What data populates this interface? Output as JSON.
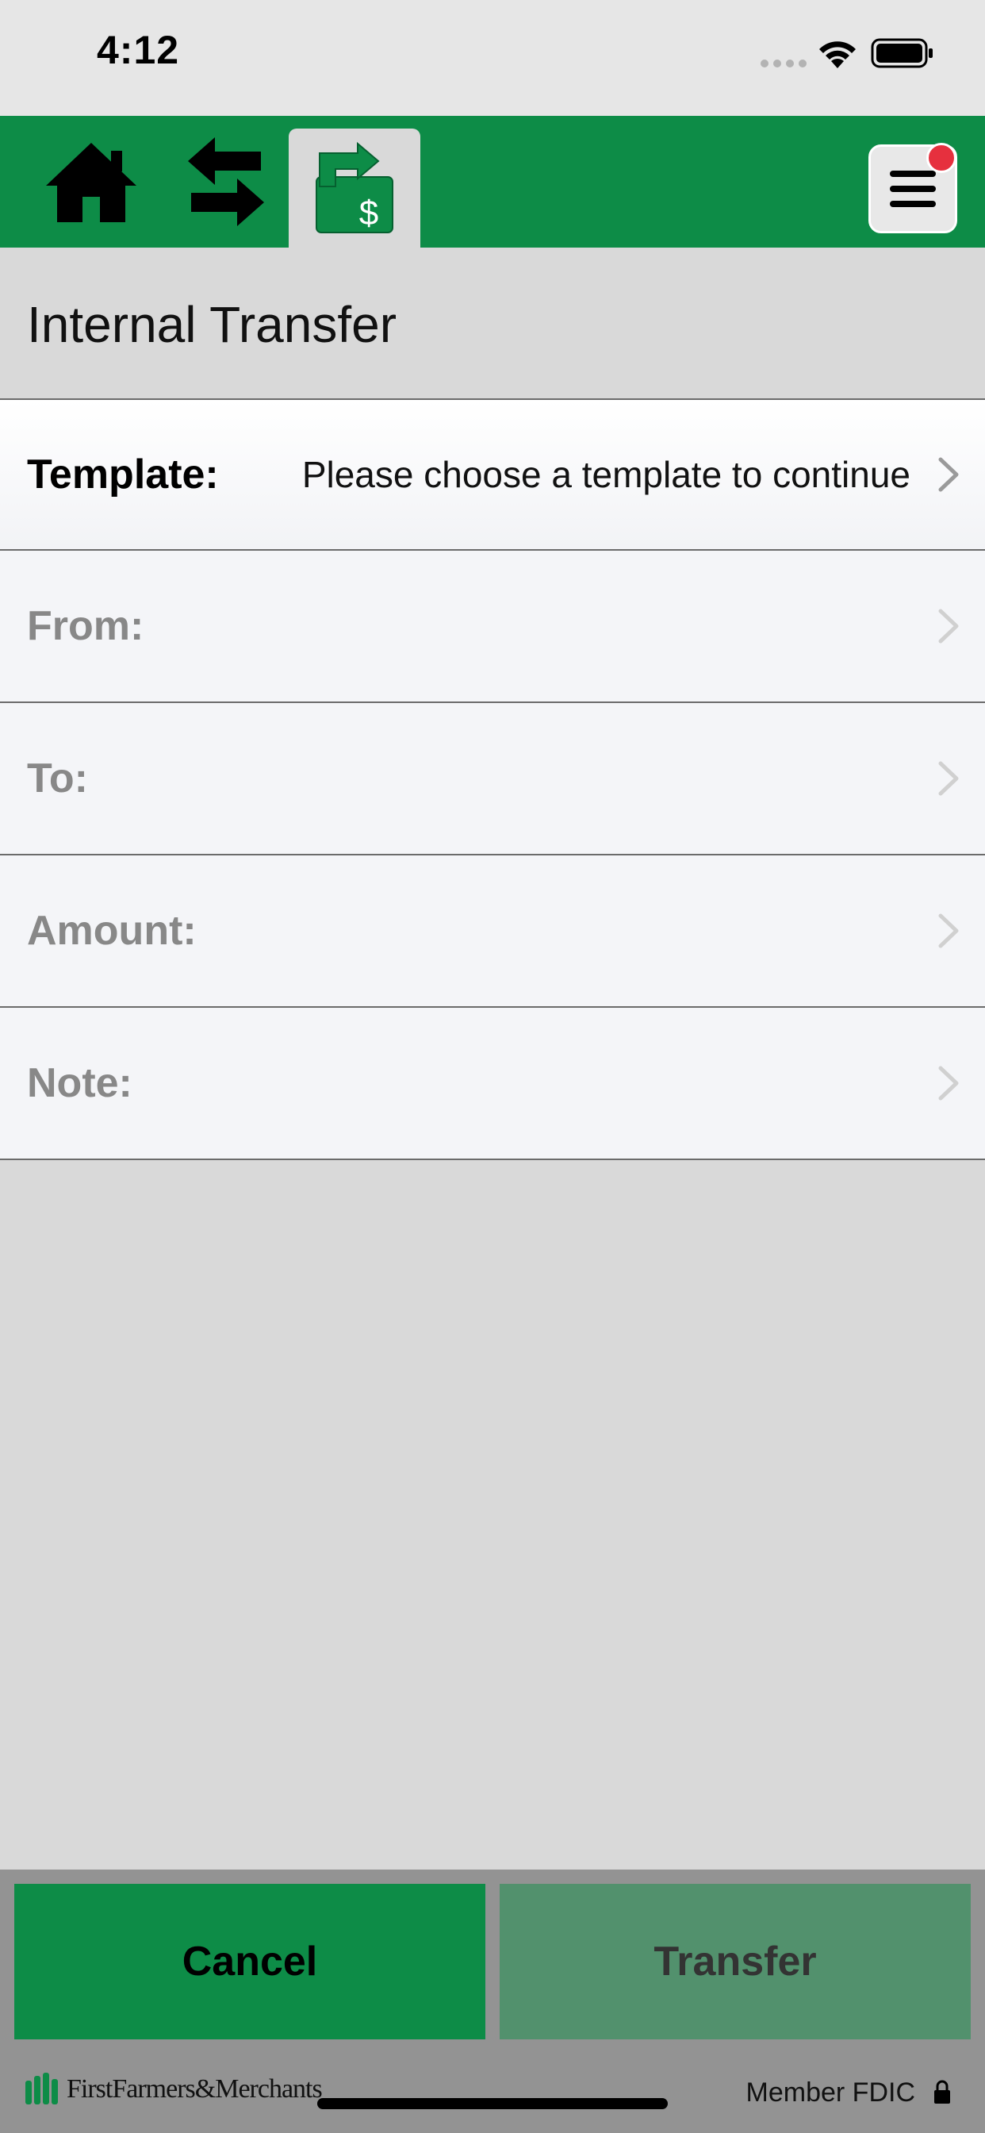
{
  "status_bar": {
    "time": "4:12"
  },
  "nav": {
    "home_icon": "home-icon",
    "swap_icon": "swap-arrows-icon",
    "transfer_icon": "transfer-dollar-icon",
    "menu_icon": "hamburger-menu-icon",
    "active_tab": "transfer",
    "has_notification": true
  },
  "page": {
    "title": "Internal Transfer"
  },
  "form": {
    "rows": [
      {
        "label": "Template:",
        "value": "Please choose a template to continue"
      },
      {
        "label": "From:",
        "value": ""
      },
      {
        "label": "To:",
        "value": ""
      },
      {
        "label": "Amount:",
        "value": ""
      },
      {
        "label": "Note:",
        "value": ""
      }
    ]
  },
  "actions": {
    "cancel_label": "Cancel",
    "transfer_label": "Transfer"
  },
  "footer": {
    "bank_name": "FirstFarmers&Merchants",
    "fdic_text": "Member FDIC"
  },
  "colors": {
    "brand_green": "#0d8c47",
    "disabled_green": "#52916d",
    "notification_red": "#e6303e"
  }
}
